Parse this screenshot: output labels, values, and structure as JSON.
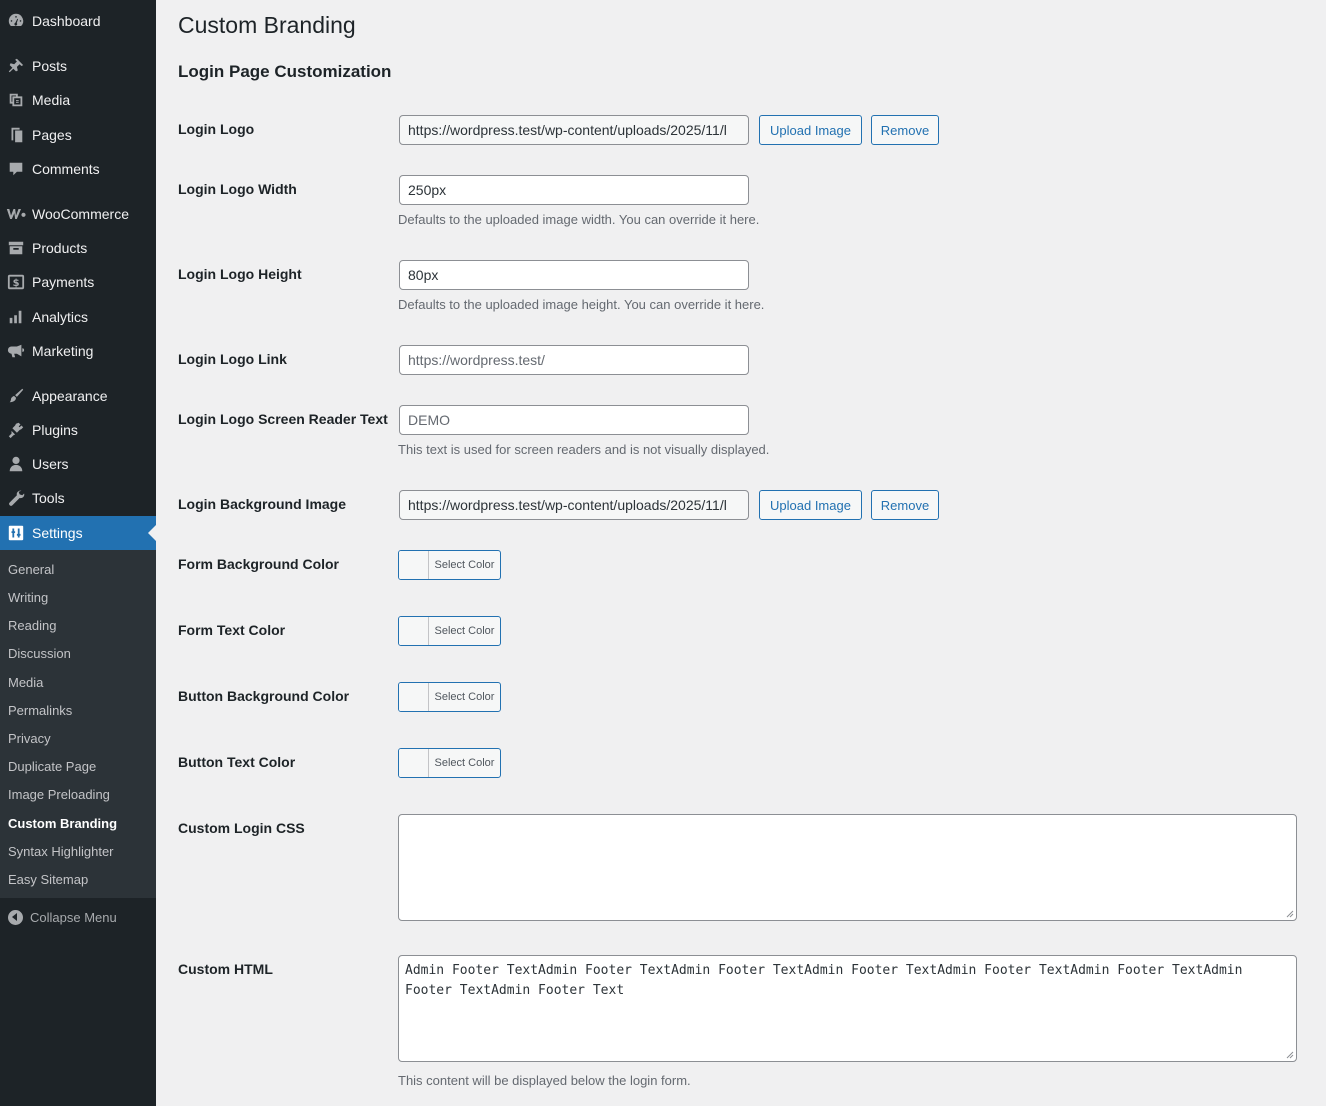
{
  "sidebar": {
    "items": [
      {
        "label": "Dashboard",
        "icon": "dashboard-icon"
      },
      {
        "label": "Posts",
        "icon": "pin-icon"
      },
      {
        "label": "Media",
        "icon": "media-icon"
      },
      {
        "label": "Pages",
        "icon": "pages-icon"
      },
      {
        "label": "Comments",
        "icon": "comment-icon"
      },
      {
        "label": "WooCommerce",
        "icon": "woocommerce-icon"
      },
      {
        "label": "Products",
        "icon": "archive-icon"
      },
      {
        "label": "Payments",
        "icon": "dollar-icon"
      },
      {
        "label": "Analytics",
        "icon": "bar-chart-icon"
      },
      {
        "label": "Marketing",
        "icon": "megaphone-icon"
      },
      {
        "label": "Appearance",
        "icon": "paintbrush-icon"
      },
      {
        "label": "Plugins",
        "icon": "plug-icon"
      },
      {
        "label": "Users",
        "icon": "user-icon"
      },
      {
        "label": "Tools",
        "icon": "wrench-icon"
      },
      {
        "label": "Settings",
        "icon": "settings-icon"
      }
    ],
    "submenu": [
      "General",
      "Writing",
      "Reading",
      "Discussion",
      "Media",
      "Permalinks",
      "Privacy",
      "Duplicate Page",
      "Image Preloading",
      "Custom Branding",
      "Syntax Highlighter",
      "Easy Sitemap"
    ],
    "current_item": "Settings",
    "current_subitem": "Custom Branding",
    "collapse_label": "Collapse Menu"
  },
  "page": {
    "title": "Custom Branding",
    "section_title": "Login Page Customization"
  },
  "fields": {
    "login_logo": {
      "label": "Login Logo",
      "value": "https://wordpress.test/wp-content/uploads/2025/11/l",
      "upload": "Upload Image",
      "remove": "Remove"
    },
    "login_logo_width": {
      "label": "Login Logo Width",
      "value": "250px",
      "description": "Defaults to the uploaded image width. You can override it here."
    },
    "login_logo_height": {
      "label": "Login Logo Height",
      "value": "80px",
      "description": "Defaults to the uploaded image height. You can override it here."
    },
    "login_logo_link": {
      "label": "Login Logo Link",
      "placeholder": "https://wordpress.test/"
    },
    "login_logo_sr_text": {
      "label": "Login Logo Screen Reader Text",
      "placeholder": "DEMO",
      "description": "This text is used for screen readers and is not visually displayed."
    },
    "login_bg_image": {
      "label": "Login Background Image",
      "value": "https://wordpress.test/wp-content/uploads/2025/11/l",
      "upload": "Upload Image",
      "remove": "Remove"
    },
    "form_bg_color": {
      "label": "Form Background Color",
      "button": "Select Color"
    },
    "form_text_color": {
      "label": "Form Text Color",
      "button": "Select Color"
    },
    "button_bg_color": {
      "label": "Button Background Color",
      "button": "Select Color"
    },
    "button_text_color": {
      "label": "Button Text Color",
      "button": "Select Color"
    },
    "custom_login_css": {
      "label": "Custom Login CSS",
      "value": ""
    },
    "custom_html": {
      "label": "Custom HTML",
      "value": "Admin Footer TextAdmin Footer TextAdmin Footer TextAdmin Footer TextAdmin Footer TextAdmin Footer TextAdmin Footer TextAdmin Footer Text",
      "description": "This content will be displayed below the login form."
    }
  },
  "colors": {
    "sidebar_bg": "#1d2327",
    "submenu_bg": "#2c3338",
    "accent": "#2271b1",
    "page_bg": "#f0f0f1"
  }
}
